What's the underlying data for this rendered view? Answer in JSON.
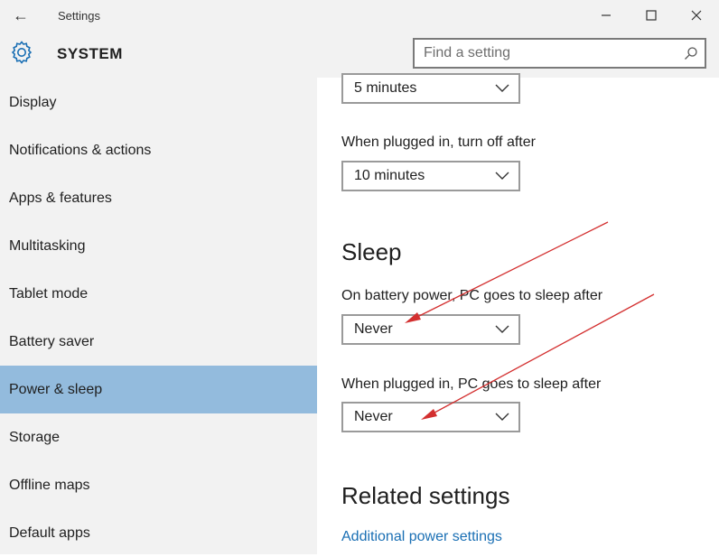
{
  "window": {
    "title": "Settings",
    "back_icon": "arrow-left-icon",
    "controls": [
      "minimize-icon",
      "maximize-icon",
      "close-icon"
    ]
  },
  "header": {
    "title": "SYSTEM",
    "icon": "gear-icon",
    "search_placeholder": "Find a setting"
  },
  "sidebar": {
    "items": [
      {
        "label": "Display"
      },
      {
        "label": "Notifications & actions"
      },
      {
        "label": "Apps & features"
      },
      {
        "label": "Multitasking"
      },
      {
        "label": "Tablet mode"
      },
      {
        "label": "Battery saver"
      },
      {
        "label": "Power & sleep",
        "active": true
      },
      {
        "label": "Storage"
      },
      {
        "label": "Offline maps"
      },
      {
        "label": "Default apps"
      }
    ]
  },
  "content": {
    "screen_battery_value": "5 minutes",
    "screen_plugged_label": "When plugged in, turn off after",
    "screen_plugged_value": "10 minutes",
    "sleep_heading": "Sleep",
    "sleep_battery_label": "On battery power, PC goes to sleep after",
    "sleep_battery_value": "Never",
    "sleep_plugged_label": "When plugged in, PC goes to sleep after",
    "sleep_plugged_value": "Never",
    "related_heading": "Related settings",
    "related_link": "Additional power settings"
  },
  "colors": {
    "accent": "#1a6fb4",
    "active_nav": "#93bbdd",
    "annotation_arrow": "#d32f2f"
  }
}
